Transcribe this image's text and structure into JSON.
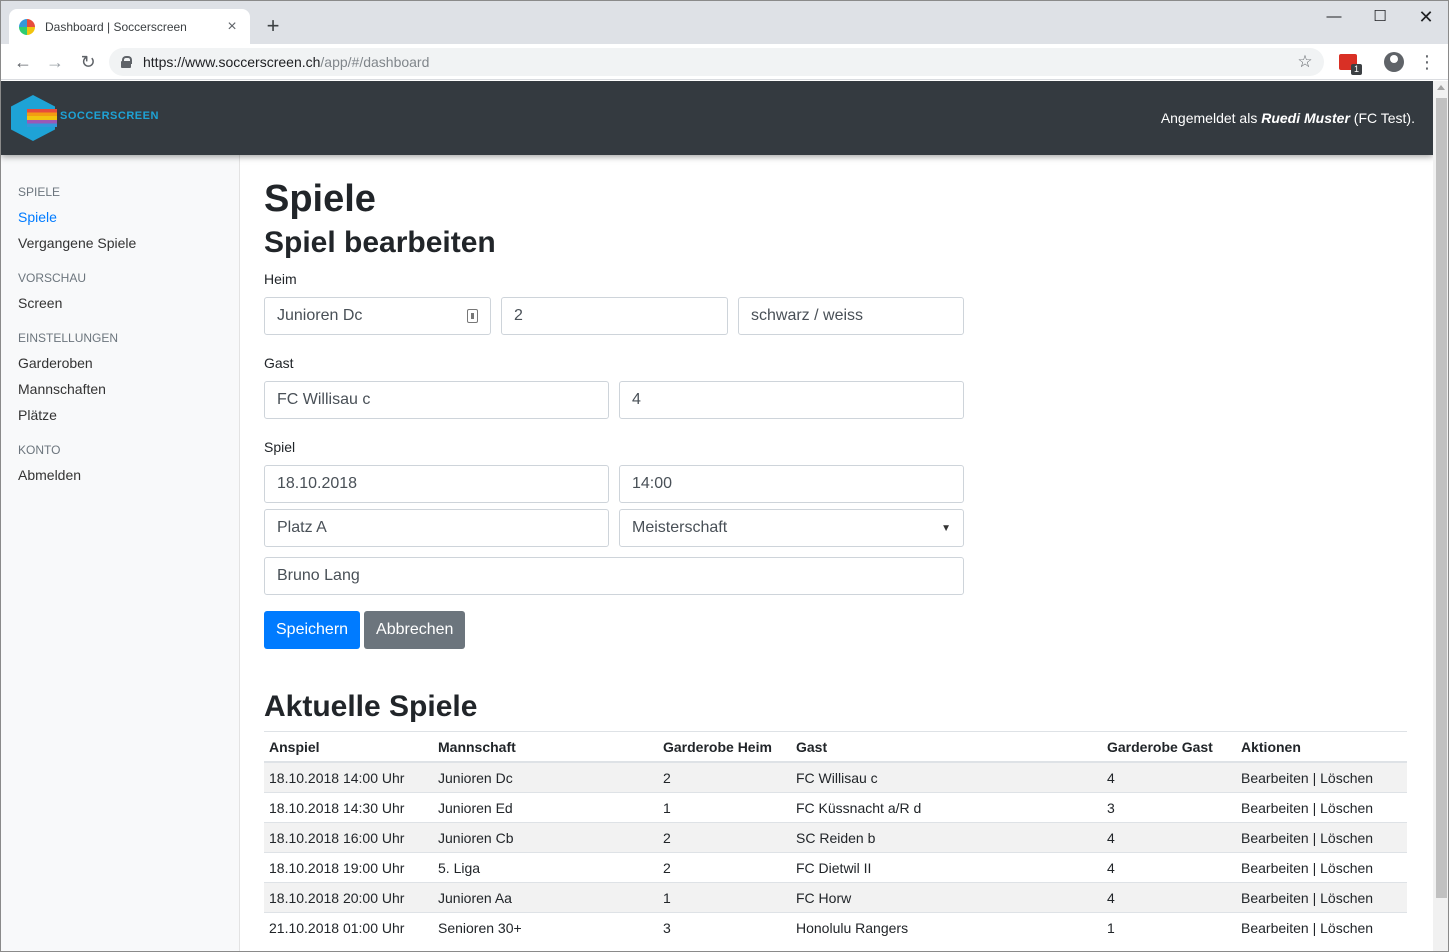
{
  "browser": {
    "tab_title": "Dashboard | Soccerscreen",
    "url_host": "https://www.soccerscreen.ch",
    "url_path": "/app/#/dashboard",
    "extension_badge": "1"
  },
  "header": {
    "logo_text": "SOCCERSCREEN",
    "logged_in_prefix": "Angemeldet als",
    "user_name": "Ruedi Muster",
    "club": "(FC Test)."
  },
  "sidebar": {
    "groups": [
      {
        "heading": "SPIELE",
        "items": [
          "Spiele",
          "Vergangene Spiele"
        ]
      },
      {
        "heading": "VORSCHAU",
        "items": [
          "Screen"
        ]
      },
      {
        "heading": "EINSTELLUNGEN",
        "items": [
          "Garderoben",
          "Mannschaften",
          "Plätze"
        ]
      },
      {
        "heading": "KONTO",
        "items": [
          "Abmelden"
        ]
      }
    ]
  },
  "main": {
    "title": "Spiele",
    "form_title": "Spiel bearbeiten",
    "heim_label": "Heim",
    "heim_team": "Junioren Dc",
    "heim_garderobe": "2",
    "heim_farbe": "schwarz / weiss",
    "gast_label": "Gast",
    "gast_team": "FC Willisau c",
    "gast_garderobe": "4",
    "spiel_label": "Spiel",
    "datum": "18.10.2018",
    "zeit": "14:00",
    "platz": "Platz A",
    "typ": "Meisterschaft",
    "schiedsrichter": "Bruno Lang",
    "save_label": "Speichern",
    "cancel_label": "Abbrechen",
    "list_title": "Aktuelle Spiele"
  },
  "table": {
    "headers": [
      "Anspiel",
      "Mannschaft",
      "Garderobe Heim",
      "Gast",
      "Garderobe Gast",
      "Aktionen"
    ],
    "edit_label": "Bearbeiten",
    "separator": "|",
    "delete_label": "Löschen",
    "rows": [
      [
        "18.10.2018 14:00 Uhr",
        "Junioren Dc",
        "2",
        "FC Willisau c",
        "4"
      ],
      [
        "18.10.2018 14:30 Uhr",
        "Junioren Ed",
        "1",
        "FC Küssnacht a/R d",
        "3"
      ],
      [
        "18.10.2018 16:00 Uhr",
        "Junioren Cb",
        "2",
        "SC Reiden b",
        "4"
      ],
      [
        "18.10.2018 19:00 Uhr",
        "5. Liga",
        "2",
        "FC Dietwil II",
        "4"
      ],
      [
        "18.10.2018 20:00 Uhr",
        "Junioren Aa",
        "1",
        "FC Horw",
        "4"
      ],
      [
        "21.10.2018 01:00 Uhr",
        "Senioren 30+",
        "3",
        "Honolulu Rangers",
        "1"
      ]
    ]
  }
}
